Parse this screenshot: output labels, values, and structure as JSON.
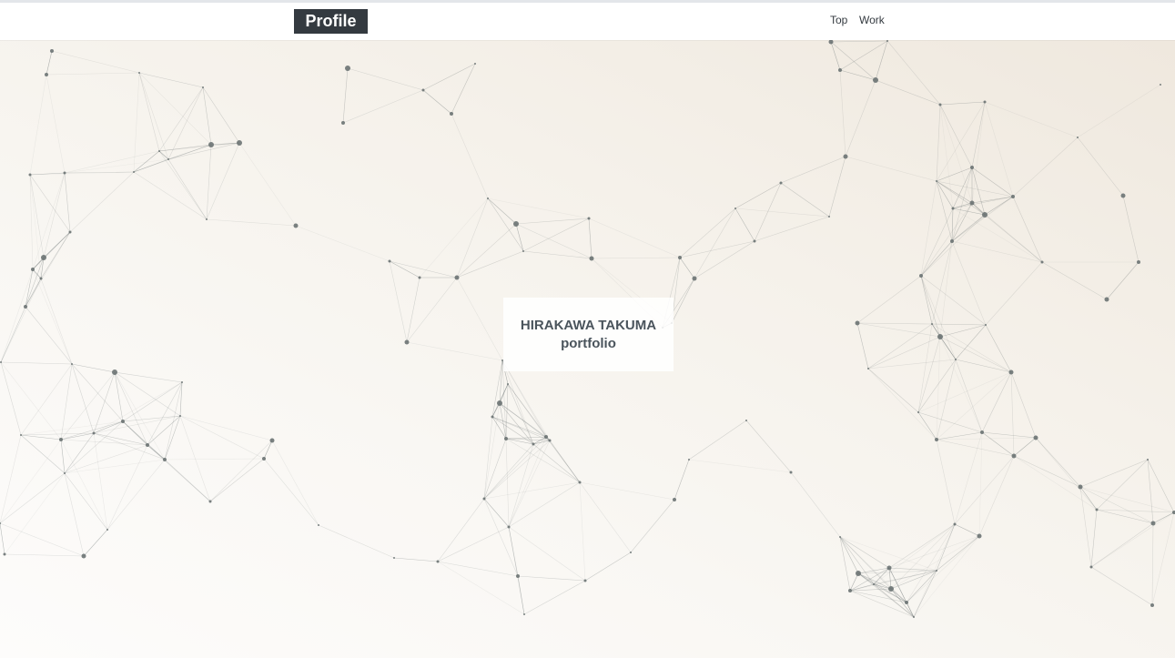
{
  "header": {
    "brand": "Profile",
    "nav": [
      {
        "label": "Top"
      },
      {
        "label": "Work"
      }
    ]
  },
  "hero": {
    "name": "HIRAKAWA TAKUMA",
    "subtitle": "portfolio"
  },
  "colors": {
    "brand_bg": "#343a40",
    "brand_text": "#ffffff",
    "text": "#4a545c",
    "particle": "#6b7373",
    "hero_bg_from": "#efe8de",
    "hero_bg_to": "#fdfcfb"
  }
}
